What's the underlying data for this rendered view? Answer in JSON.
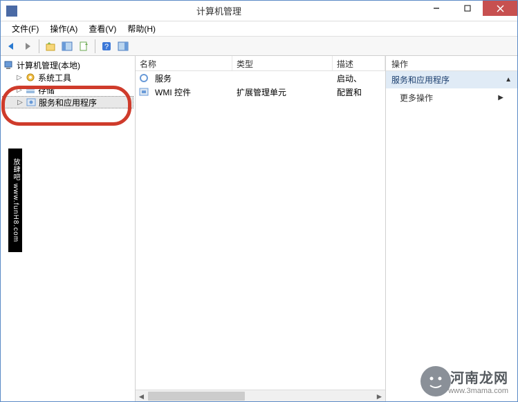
{
  "title": "计算机管理",
  "menu": {
    "file": "文件(F)",
    "action": "操作(A)",
    "view": "查看(V)",
    "help": "帮助(H)"
  },
  "tree": {
    "root": "计算机管理(本地)",
    "item_tools": "系统工具",
    "item_storage": "存储",
    "item_services_apps": "服务和应用程序"
  },
  "list": {
    "headers": {
      "name": "名称",
      "type": "类型",
      "desc": "描述"
    },
    "rows": [
      {
        "name": "服务",
        "type": "",
        "desc": "启动、"
      },
      {
        "name": "WMI 控件",
        "type": "扩展管理单元",
        "desc": "配置和"
      }
    ]
  },
  "actions": {
    "header": "操作",
    "context_title": "服务和应用程序",
    "more": "更多操作"
  },
  "sidebar_label": "放肆吧 www.funH8.com",
  "watermark": {
    "line1": "河南龙网",
    "line2": "www.3mama.com"
  }
}
